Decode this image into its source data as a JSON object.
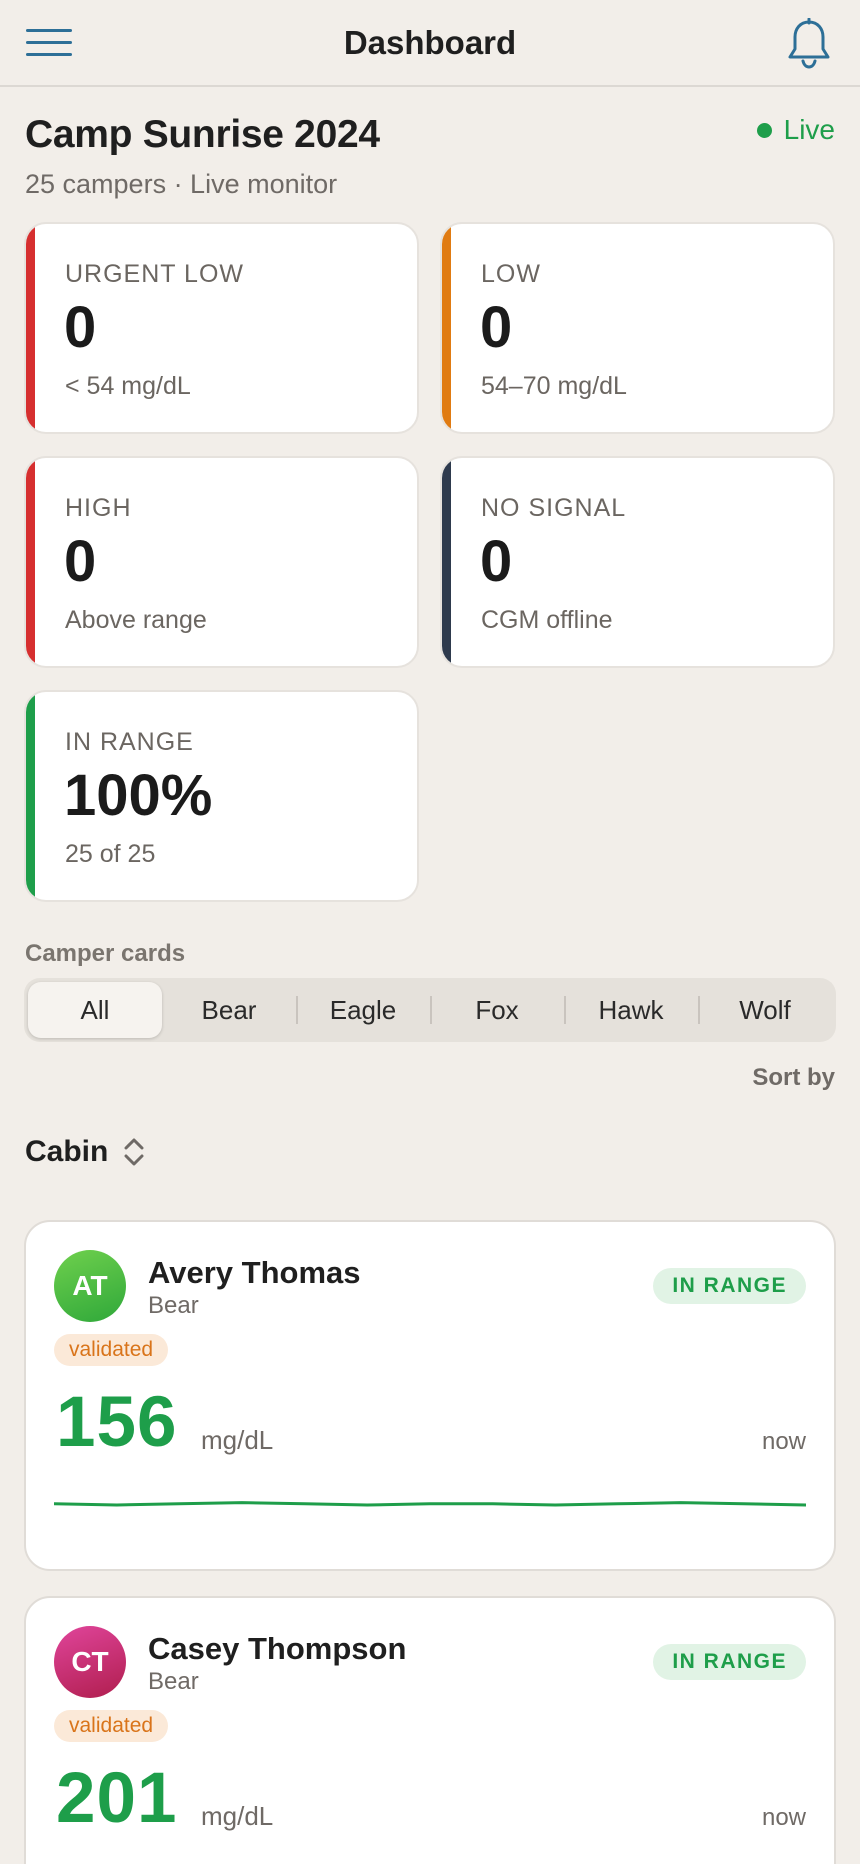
{
  "header": {
    "title": "Dashboard"
  },
  "camp": {
    "name": "Camp Sunrise 2024",
    "subtitle": "25 campers · Live monitor",
    "status": "Live"
  },
  "stats": [
    {
      "label": "URGENT LOW",
      "value": "0",
      "note": "< 54 mg/dL",
      "color": "#d62f2f"
    },
    {
      "label": "LOW",
      "value": "0",
      "note": "54–70 mg/dL",
      "color": "#e07b12"
    },
    {
      "label": "HIGH",
      "value": "0",
      "note": "Above range",
      "color": "#d62f2f"
    },
    {
      "label": "NO SIGNAL",
      "value": "0",
      "note": "CGM offline",
      "color": "#2e3a4d"
    },
    {
      "label": "IN RANGE",
      "value": "100%",
      "note": "25 of 25",
      "color": "#1e9e4a"
    }
  ],
  "filter": {
    "label": "Camper cards",
    "options": [
      "All",
      "Bear",
      "Eagle",
      "Fox",
      "Hawk",
      "Wolf"
    ],
    "selected": "All"
  },
  "sort": {
    "label": "Sort by",
    "value": "Cabin"
  },
  "campers": [
    {
      "initials": "AT",
      "name": "Avery Thomas",
      "cabin": "Bear",
      "status": "IN RANGE",
      "tag": "validated",
      "glucose": "156",
      "unit": "mg/dL",
      "time": "now",
      "trend": [
        156,
        155,
        156,
        157,
        156,
        155,
        156,
        156,
        155,
        156,
        157,
        156,
        155
      ],
      "avatar_colors": [
        "#6fd04d",
        "#2fa83a"
      ]
    },
    {
      "initials": "CT",
      "name": "Casey Thompson",
      "cabin": "Bear",
      "status": "IN RANGE",
      "tag": "validated",
      "glucose": "201",
      "unit": "mg/dL",
      "time": "now",
      "avatar_colors": [
        "#e0459b",
        "#b01e4e"
      ]
    }
  ],
  "colors": {
    "accent": "#1e9e4a",
    "icon": "#2d6f97",
    "warning": "#d9741a"
  }
}
